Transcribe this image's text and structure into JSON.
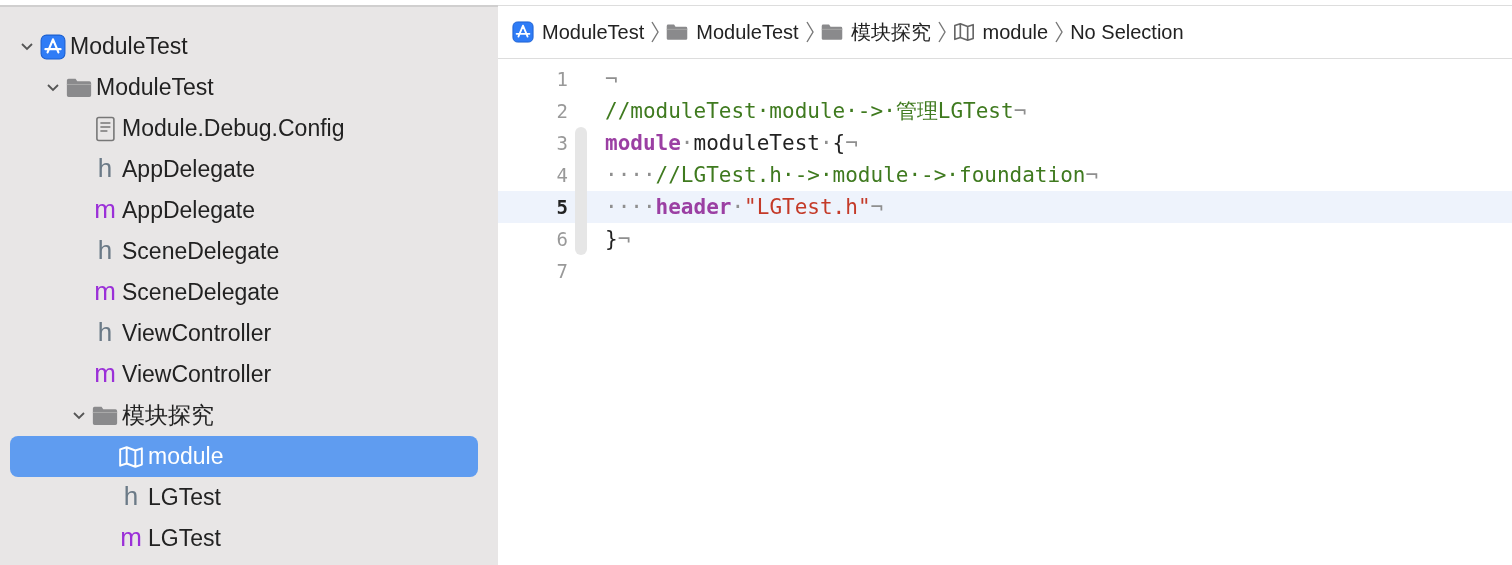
{
  "navigator": {
    "items": [
      {
        "label": "ModuleTest",
        "kind": "app",
        "expanded": true,
        "selected": false,
        "children": [
          {
            "label": "ModuleTest",
            "kind": "folder",
            "expanded": true,
            "selected": false,
            "children": [
              {
                "label": "Module.Debug.Config",
                "kind": "config",
                "selected": false
              },
              {
                "label": "AppDelegate",
                "kind": "h",
                "selected": false
              },
              {
                "label": "AppDelegate",
                "kind": "m",
                "selected": false
              },
              {
                "label": "SceneDelegate",
                "kind": "h",
                "selected": false
              },
              {
                "label": "SceneDelegate",
                "kind": "m",
                "selected": false
              },
              {
                "label": "ViewController",
                "kind": "h",
                "selected": false
              },
              {
                "label": "ViewController",
                "kind": "m",
                "selected": false
              },
              {
                "label": "模块探究",
                "kind": "folder",
                "expanded": true,
                "selected": false,
                "children": [
                  {
                    "label": "module",
                    "kind": "map",
                    "selected": true
                  },
                  {
                    "label": "LGTest",
                    "kind": "h",
                    "selected": false
                  },
                  {
                    "label": "LGTest",
                    "kind": "m",
                    "selected": false
                  }
                ]
              }
            ]
          }
        ]
      }
    ]
  },
  "breadcrumb": [
    {
      "label": "ModuleTest",
      "kind": "app"
    },
    {
      "label": "ModuleTest",
      "kind": "folder"
    },
    {
      "label": "模块探究",
      "kind": "folder"
    },
    {
      "label": "module",
      "kind": "map"
    },
    {
      "label": "No Selection"
    }
  ],
  "editor": {
    "lines": [
      {
        "number": "1",
        "current": false,
        "tokens": [
          {
            "kind": "ws",
            "text": "¬"
          }
        ]
      },
      {
        "number": "2",
        "current": false,
        "tokens": [
          {
            "kind": "comment",
            "text": "//moduleTest·module·->·管理LGTest"
          },
          {
            "kind": "ws",
            "text": "¬"
          }
        ]
      },
      {
        "number": "3",
        "current": false,
        "tokens": [
          {
            "kind": "keyword",
            "text": "module"
          },
          {
            "kind": "ws",
            "text": "·"
          },
          {
            "kind": "plain",
            "text": "moduleTest"
          },
          {
            "kind": "ws",
            "text": "·"
          },
          {
            "kind": "plain",
            "text": "{"
          },
          {
            "kind": "ws",
            "text": "¬"
          }
        ]
      },
      {
        "number": "4",
        "current": false,
        "tokens": [
          {
            "kind": "ws",
            "text": "····"
          },
          {
            "kind": "comment",
            "text": "//LGTest.h·->·module·->·foundation"
          },
          {
            "kind": "ws",
            "text": "¬"
          }
        ]
      },
      {
        "number": "5",
        "current": true,
        "tokens": [
          {
            "kind": "ws",
            "text": "····"
          },
          {
            "kind": "keyword",
            "text": "header"
          },
          {
            "kind": "ws",
            "text": "·"
          },
          {
            "kind": "string",
            "text": "\"LGTest.h\""
          },
          {
            "kind": "ws",
            "text": "¬"
          }
        ]
      },
      {
        "number": "6",
        "current": false,
        "tokens": [
          {
            "kind": "plain",
            "text": "}"
          },
          {
            "kind": "ws",
            "text": "¬"
          }
        ]
      },
      {
        "number": "7",
        "current": false
      }
    ]
  }
}
